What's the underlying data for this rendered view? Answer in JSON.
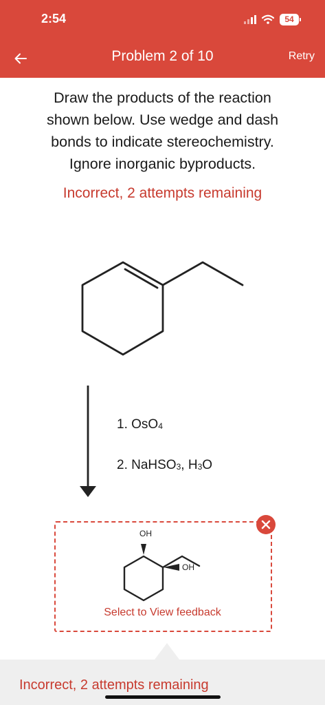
{
  "status_bar": {
    "time": "2:54",
    "battery": "54"
  },
  "nav": {
    "title": "Problem 2 of 10",
    "retry_label": "Retry"
  },
  "question": {
    "lines": [
      "Draw the products of the reaction",
      "shown below. Use wedge and dash",
      "bonds to indicate stereochemistry.",
      "Ignore inorganic byproducts."
    ]
  },
  "status_message": "Incorrect, 2 attempts remaining",
  "reaction": {
    "step1": {
      "num": "1. ",
      "base": "OsO",
      "sub": "4"
    },
    "step2": {
      "num": "2. ",
      "base1": "NaHSO",
      "sub1": "3",
      "sep": ", H",
      "sub2": "3",
      "end": "O"
    }
  },
  "answer": {
    "oh_top": "OH",
    "oh_right": "OH",
    "feedback_link": "Select to View feedback"
  },
  "footer": {
    "message": "Incorrect, 2 attempts remaining"
  },
  "colors": {
    "accent": "#d9483b",
    "error_text": "#c73a2e"
  }
}
